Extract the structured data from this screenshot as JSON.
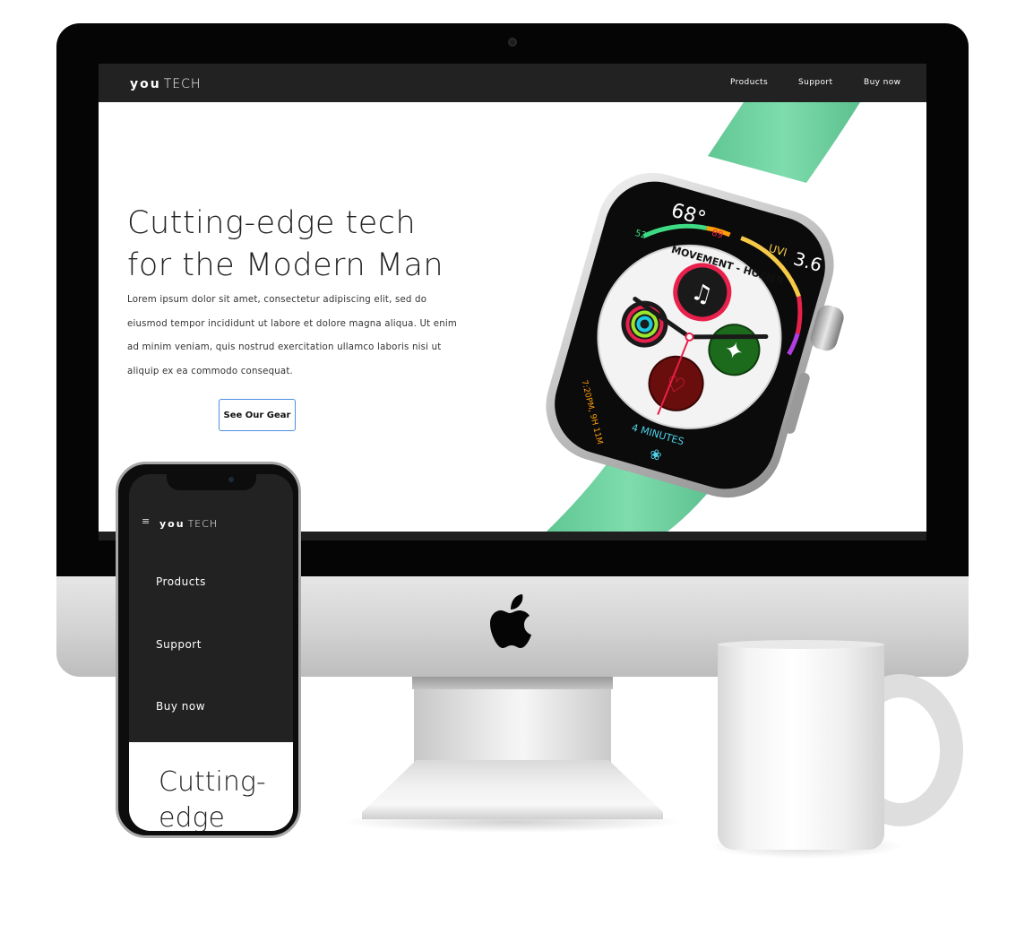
{
  "desktop": {
    "logo": {
      "you": "you",
      "tech": "TECH"
    },
    "nav": [
      {
        "label": "Products"
      },
      {
        "label": "Support"
      },
      {
        "label": "Buy now"
      }
    ],
    "hero": {
      "title_line1": "Cutting-edge tech",
      "title_line2": "for the Modern Man",
      "body": "Lorem ipsum dolor sit amet, consectetur adipiscing elit, sed do eiusmod tempor incididunt ut labore et dolore magna aliqua. Ut enim ad minim veniam, quis nostrud exercitation ullamco laboris nisi ut aliquip ex ea commodo consequat.",
      "cta_label": "See Our Gear"
    }
  },
  "watch_face": {
    "temperature": "68°",
    "temp_low": "52",
    "temp_high": "89",
    "uvi_label": "UVI",
    "uvi_value": "3.6",
    "now_playing": "MOVEMENT - HOZIER",
    "sunset": "7:20PM, 9H 11M",
    "timer": "4 MINUTES"
  },
  "mobile": {
    "logo": {
      "you": "you",
      "tech": "TECH"
    },
    "menu_icon": "hamburger-icon",
    "nav": [
      {
        "label": "Products"
      },
      {
        "label": "Support"
      },
      {
        "label": "Buy now"
      }
    ],
    "hero": {
      "title_line1": "Cutting-",
      "title_line2": "edge"
    }
  },
  "colors": {
    "nav_bg": "#222222",
    "cta_border": "#4c8fe0",
    "band_green": "#6fd4a2"
  }
}
